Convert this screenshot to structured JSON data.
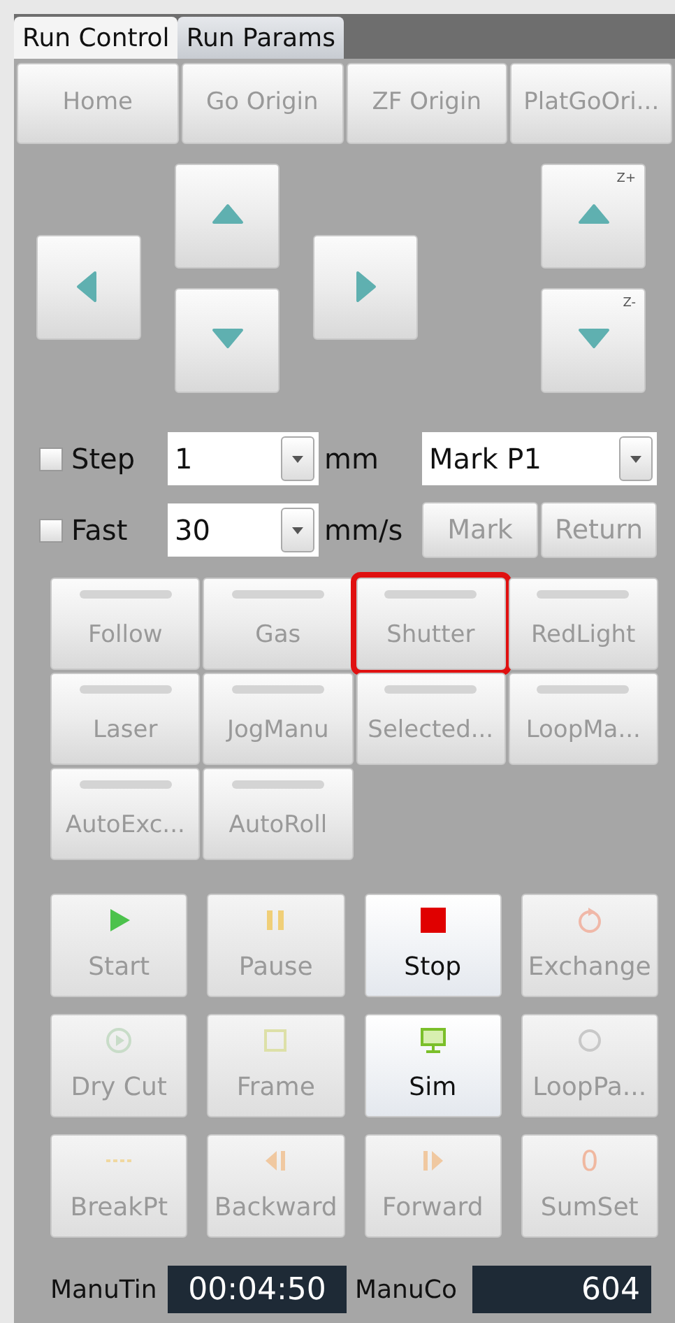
{
  "tabs": [
    {
      "label": "Run Control",
      "selected": true
    },
    {
      "label": "Run Params",
      "selected": false
    }
  ],
  "origin_buttons": [
    "Home",
    "Go Origin",
    "ZF Origin",
    "PlatGoOri..."
  ],
  "jog": {
    "z_up_label": "Z+",
    "z_down_label": "Z-"
  },
  "step": {
    "label": "Step",
    "checked": false,
    "value": "1",
    "unit": "mm",
    "mark_select": "Mark P1"
  },
  "fast": {
    "label": "Fast",
    "checked": false,
    "value": "30",
    "unit": "mm/s",
    "buttons": [
      "Mark",
      "Return"
    ]
  },
  "toggles": [
    {
      "label": "Follow",
      "highlighted": false
    },
    {
      "label": "Gas",
      "highlighted": false
    },
    {
      "label": "Shutter",
      "highlighted": true
    },
    {
      "label": "RedLight",
      "highlighted": false
    },
    {
      "label": "Laser",
      "highlighted": false
    },
    {
      "label": "JogManu",
      "highlighted": false
    },
    {
      "label": "Selected...",
      "highlighted": false
    },
    {
      "label": "LoopMa...",
      "highlighted": false
    },
    {
      "label": "AutoExc...",
      "highlighted": false
    },
    {
      "label": "AutoRoll",
      "highlighted": false
    }
  ],
  "actions": [
    {
      "label": "Start",
      "kind": "play",
      "enabled": false
    },
    {
      "label": "Pause",
      "kind": "pause",
      "enabled": false
    },
    {
      "label": "Stop",
      "kind": "stop",
      "enabled": true
    },
    {
      "label": "Exchange",
      "kind": "exchange",
      "enabled": false
    },
    {
      "label": "Dry Cut",
      "kind": "drycut",
      "enabled": false
    },
    {
      "label": "Frame",
      "kind": "frame",
      "enabled": false
    },
    {
      "label": "Sim",
      "kind": "sim",
      "enabled": true
    },
    {
      "label": "LoopPa...",
      "kind": "loop",
      "enabled": false
    },
    {
      "label": "BreakPt",
      "kind": "breakpoint",
      "enabled": false
    },
    {
      "label": "Backward",
      "kind": "backward",
      "enabled": false
    },
    {
      "label": "Forward",
      "kind": "forward",
      "enabled": false
    },
    {
      "label": "SumSet",
      "kind": "glyph",
      "glyph": "0",
      "enabled": false
    }
  ],
  "status": [
    {
      "label": "ManuTin",
      "value": "00:04:50"
    },
    {
      "label": "ManuCo",
      "value": "604"
    }
  ]
}
